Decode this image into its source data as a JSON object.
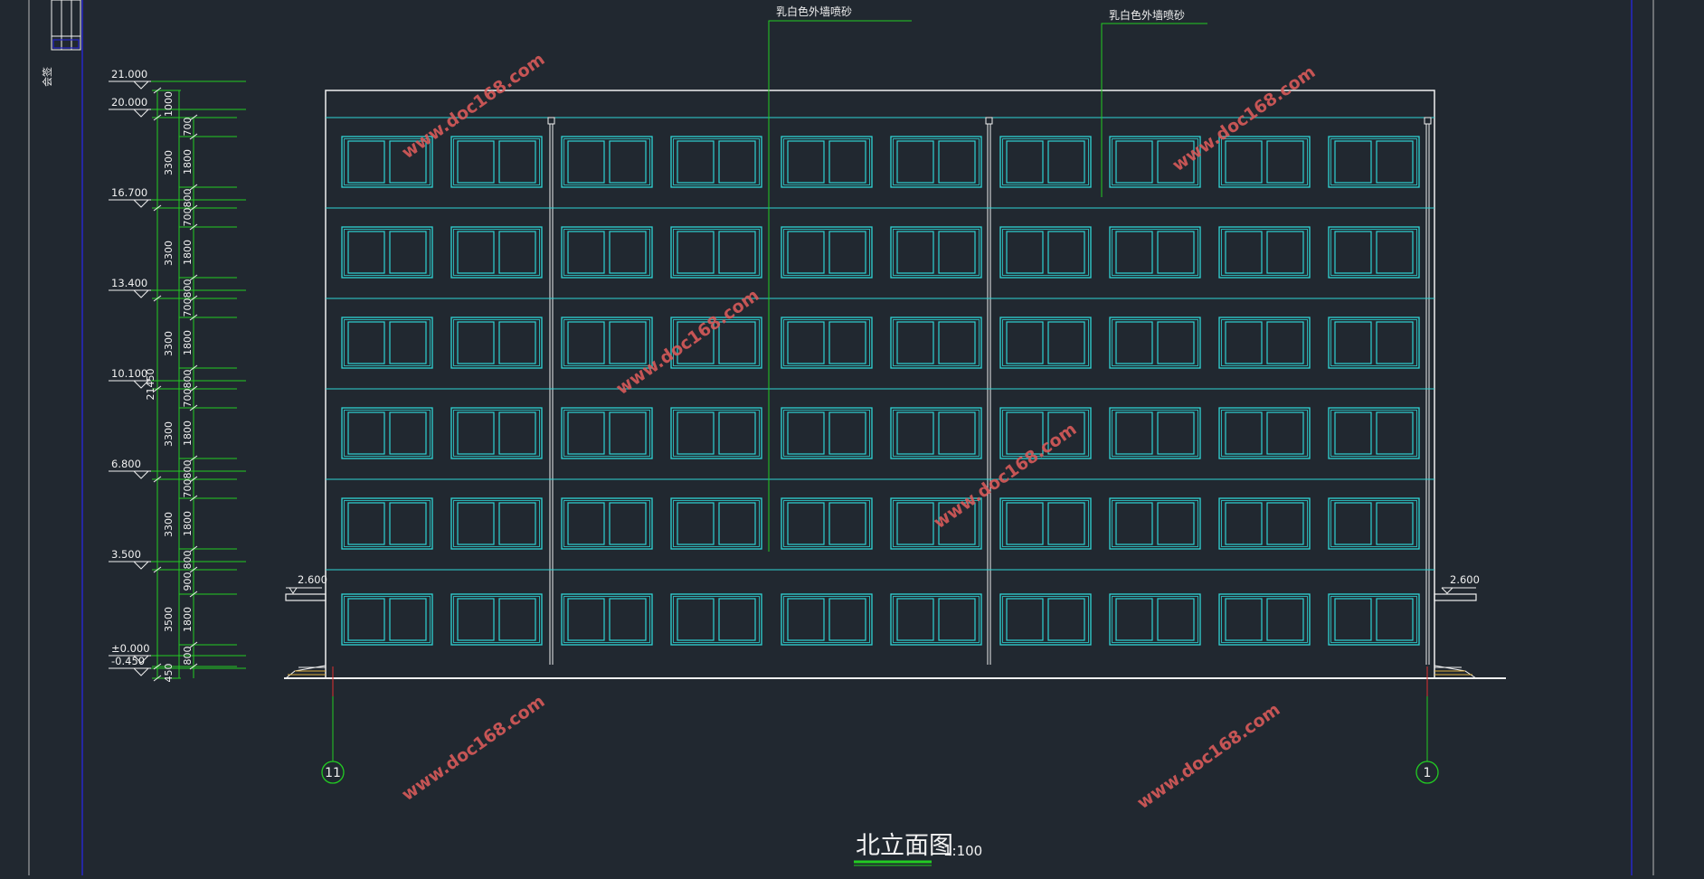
{
  "drawing": {
    "title": "北立面图",
    "scale": "1:100",
    "notes": [
      "乳白色外墙喷砂",
      "乳白色外墙喷砂"
    ],
    "axes": [
      "11",
      "1"
    ],
    "side_label": "会签",
    "canopy_levels": [
      "2.600",
      "2.600"
    ]
  },
  "levels": [
    "21.000",
    "20.000",
    "16.700",
    "13.400",
    "10.100",
    "6.800",
    "3.500",
    "±0.000",
    "-0.450"
  ],
  "dimensions": {
    "floor_heights": [
      "1000",
      "3300",
      "3300",
      "3300",
      "3300",
      "3300",
      "3500",
      "450"
    ],
    "detail": [
      "700",
      "1800",
      "800",
      "700",
      "1800",
      "800",
      "700",
      "1800",
      "800",
      "700",
      "1800",
      "800",
      "700",
      "1800",
      "800",
      "900",
      "1800",
      "800"
    ],
    "total": "21450"
  },
  "watermark": "www.doc168.com",
  "colors": {
    "background": "#212830",
    "outline": "#f0f0f0",
    "window": "#2fd3d3",
    "dimension": "#22cc22",
    "watermark": "#d85a5a",
    "frame": "#2727c8"
  }
}
